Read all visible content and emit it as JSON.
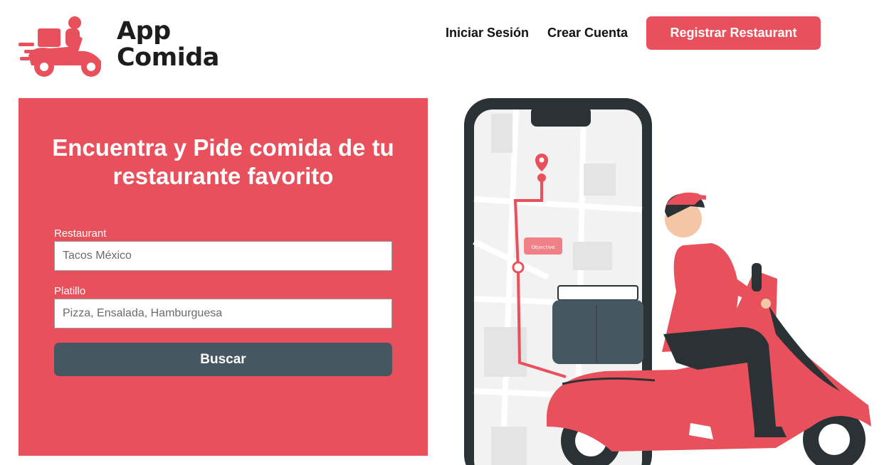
{
  "brand": {
    "name_line1": "App",
    "name_line2": "Comida",
    "logo_icon": "delivery-scooter-icon",
    "accent_color": "#e8505c",
    "dark_color": "#475762"
  },
  "nav": {
    "login_label": "Iniciar Sesión",
    "signup_label": "Crear Cuenta",
    "register_restaurant_label": "Registrar Restaurant"
  },
  "hero": {
    "headline": "Encuentra y Pide comida de tu restaurante favorito",
    "restaurant_label": "Restaurant",
    "restaurant_placeholder": "Tacos México",
    "dish_label": "Platillo",
    "dish_placeholder": "Pizza, Ensalada, Hamburguesa",
    "search_label": "Buscar"
  },
  "illustration": {
    "subject": "delivery-rider-illustration",
    "map_bubble": "Objective"
  }
}
